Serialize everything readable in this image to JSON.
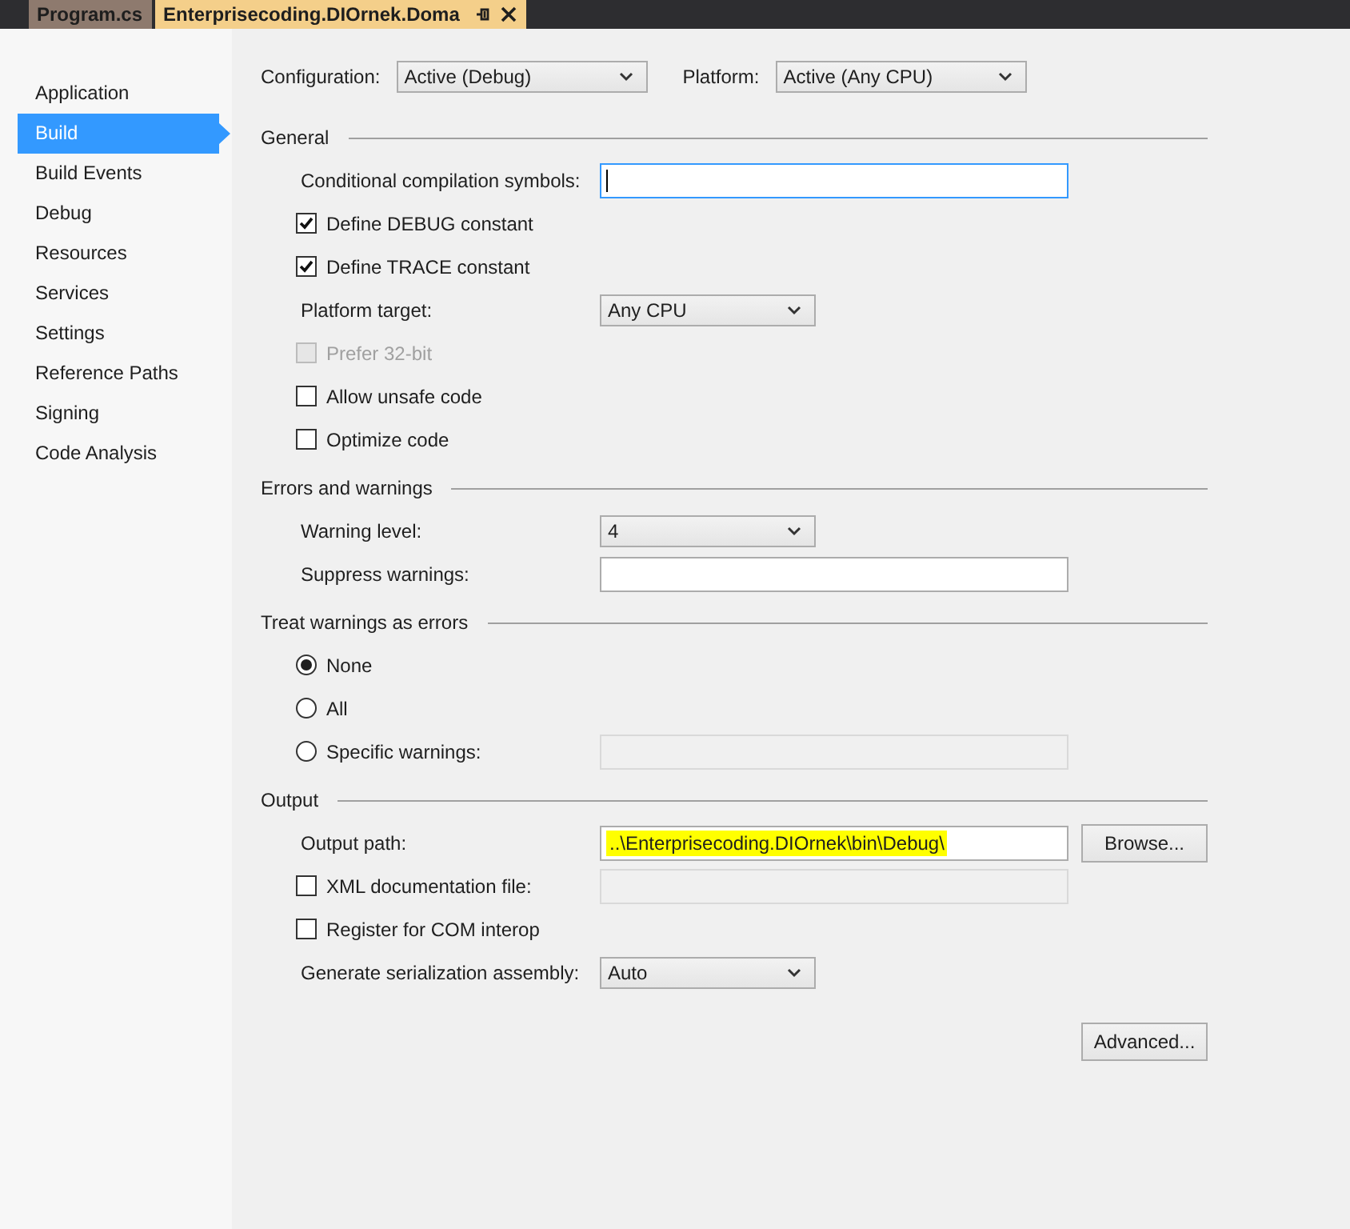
{
  "tabs": [
    {
      "label": "Program.cs",
      "selected": false
    },
    {
      "label": "Enterprisecoding.DIOrnek.Doma",
      "selected": true
    }
  ],
  "sidebar": {
    "items": [
      {
        "label": "Application",
        "selected": false
      },
      {
        "label": "Build",
        "selected": true
      },
      {
        "label": "Build Events",
        "selected": false
      },
      {
        "label": "Debug",
        "selected": false
      },
      {
        "label": "Resources",
        "selected": false
      },
      {
        "label": "Services",
        "selected": false
      },
      {
        "label": "Settings",
        "selected": false
      },
      {
        "label": "Reference Paths",
        "selected": false
      },
      {
        "label": "Signing",
        "selected": false
      },
      {
        "label": "Code Analysis",
        "selected": false
      }
    ]
  },
  "configuration": {
    "label": "Configuration:",
    "value": "Active (Debug)"
  },
  "platform": {
    "label": "Platform:",
    "value": "Active (Any CPU)"
  },
  "sections": [
    {
      "title": "General",
      "rows": [
        {
          "kind": "text",
          "label": "Conditional compilation symbols:",
          "focused": true,
          "disabled": false
        },
        {
          "kind": "check",
          "label": "Define DEBUG constant",
          "checked": true,
          "disabled": false
        },
        {
          "kind": "check",
          "label": "Define TRACE constant",
          "checked": true,
          "disabled": false
        },
        {
          "kind": "select",
          "label": "Platform target:",
          "value": "Any CPU"
        },
        {
          "kind": "check",
          "label": "Prefer 32-bit",
          "checked": false,
          "disabled": true
        },
        {
          "kind": "check",
          "label": "Allow unsafe code",
          "checked": false,
          "disabled": false
        },
        {
          "kind": "check",
          "label": "Optimize code",
          "checked": false,
          "disabled": false
        }
      ]
    },
    {
      "title": "Errors and warnings",
      "rows": [
        {
          "kind": "select",
          "label": "Warning level:",
          "value": "4"
        },
        {
          "kind": "text",
          "label": "Suppress warnings:",
          "focused": false,
          "disabled": false
        }
      ]
    },
    {
      "title": "Treat warnings as errors",
      "rows": [
        {
          "kind": "radio",
          "label": "None",
          "selected": true
        },
        {
          "kind": "radio",
          "label": "All",
          "selected": false
        },
        {
          "kind": "radio",
          "label": "Specific warnings:",
          "selected": false,
          "field_disabled": true
        }
      ]
    },
    {
      "title": "Output",
      "rows": [
        {
          "kind": "path",
          "label": "Output path:",
          "value": "..\\Enterprisecoding.DIOrnek\\bin\\Debug\\",
          "highlighted": true,
          "button": "Browse..."
        },
        {
          "kind": "check",
          "label": "XML documentation file:",
          "checked": false,
          "disabled": false,
          "field_disabled": true
        },
        {
          "kind": "check",
          "label": "Register for COM interop",
          "checked": false,
          "disabled": false
        },
        {
          "kind": "select",
          "label": "Generate serialization assembly:",
          "value": "Auto"
        },
        {
          "kind": "button",
          "label": "Advanced..."
        }
      ]
    }
  ]
}
